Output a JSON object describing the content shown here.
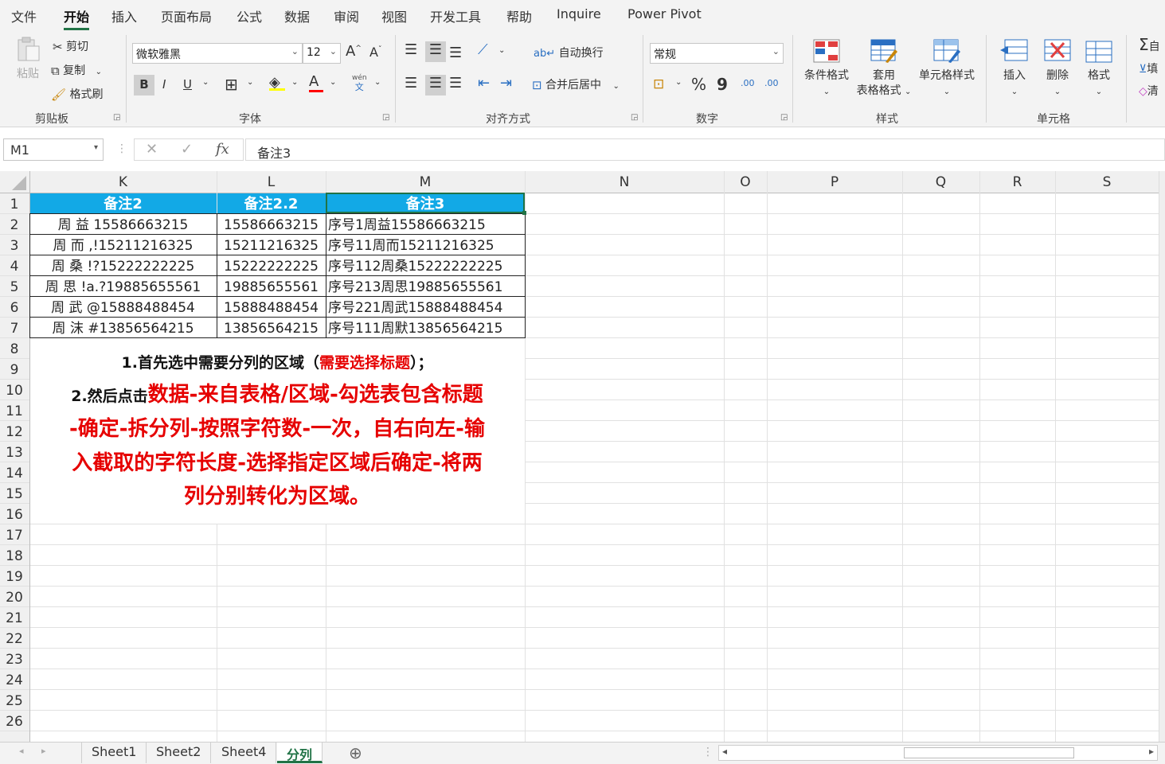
{
  "menu": {
    "tabs": [
      "文件",
      "开始",
      "插入",
      "页面布局",
      "公式",
      "数据",
      "审阅",
      "视图",
      "开发工具",
      "帮助",
      "Inquire",
      "Power Pivot"
    ],
    "active_index": 1
  },
  "ribbon": {
    "clipboard": {
      "paste": "粘贴",
      "cut": "剪切",
      "copy": "复制",
      "format_painter": "格式刷",
      "label": "剪贴板"
    },
    "font": {
      "name": "微软雅黑",
      "size": "12",
      "bold": "B",
      "italic": "I",
      "underline": "U",
      "font_color_glyph": "A",
      "phonetic_top": "wén",
      "phonetic_bottom": "文",
      "grow": "A",
      "shrink": "A",
      "label": "字体"
    },
    "alignment": {
      "wrap": "自动换行",
      "merge": "合并后居中",
      "label": "对齐方式"
    },
    "number": {
      "format": "常规",
      "percent": "%",
      "comma": "9",
      "inc_dec": ".00",
      "label": "数字"
    },
    "styles": {
      "conditional": "条件格式",
      "table_line1": "套用",
      "table_line2": "表格格式",
      "cell_styles": "单元格样式",
      "label": "样式"
    },
    "cells": {
      "insert": "插入",
      "delete": "删除",
      "format": "格式",
      "label": "单元格"
    },
    "editing": {
      "sum": "Σ",
      "sum_label": "自",
      "fill_label": "填",
      "clear_label": "清"
    }
  },
  "formula_bar": {
    "name_box": "M1",
    "fx": "fx",
    "cancel": "✕",
    "enter": "✓",
    "content": "备注3"
  },
  "grid": {
    "columns": [
      "K",
      "L",
      "M",
      "N",
      "O",
      "P",
      "Q",
      "R",
      "S"
    ],
    "row_numbers": [
      "1",
      "2",
      "3",
      "4",
      "5",
      "6",
      "7",
      "8",
      "9",
      "10",
      "11",
      "12",
      "13",
      "14",
      "15",
      "16",
      "17",
      "18",
      "19",
      "20",
      "21",
      "22",
      "23",
      "24",
      "25",
      "26"
    ],
    "headers": [
      "备注2",
      "备注2.2",
      "备注3"
    ],
    "rows": [
      [
        "周  益      15586663215",
        "15586663215",
        "序号1周益15586663215"
      ],
      [
        "周 而 ,!15211216325",
        "15211216325",
        "序号11周而15211216325"
      ],
      [
        "周   桑     !?15222222225",
        "15222222225",
        "序号112周桑15222222225"
      ],
      [
        "周   思  !a.?19885655561",
        "19885655561",
        "序号213周思19885655561"
      ],
      [
        "周   武 @15888488454",
        "15888488454",
        "序号221周武15888488454"
      ],
      [
        "周 沫 #13856564215",
        "13856564215",
        "序号111周默13856564215"
      ]
    ],
    "header_fill": "#12a9e6",
    "instructions": {
      "line1_prefix": "1.首先选中需要分列的区域（",
      "line1_red": "需要选择标题",
      "line1_suffix": "）；",
      "line2_prefix": "2.然后点击",
      "line2_red": "数据-来自表格/区域-勾选表包含标题",
      "line3": "-确定-拆分列-按照字符数-一次，自右向左-输",
      "line4": "入截取的字符长度-选择指定区域后确定-将两",
      "line5": "列分别转化为区域。"
    }
  },
  "sheets": {
    "tabs": [
      "Sheet1",
      "Sheet2",
      "Sheet4",
      "分列"
    ],
    "active_index": 3,
    "add": "⊕"
  },
  "colors": {
    "accent": "#217346",
    "instruction_red": "#e60000",
    "header_fill": "#12a9e6"
  }
}
